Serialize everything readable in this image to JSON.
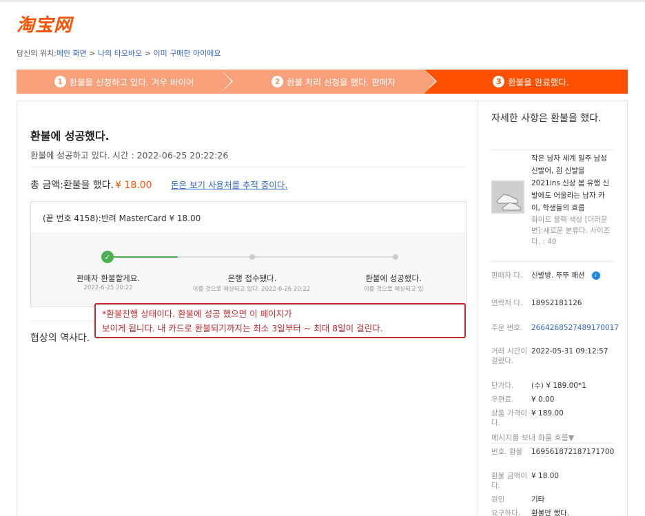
{
  "logo": "淘宝网",
  "breadcrumb": {
    "prefix": "당신의 위치:",
    "items": [
      "메인 화면",
      "나의 타오바오",
      "이미 구매한 아이에요"
    ],
    "separator": " > "
  },
  "steps": [
    {
      "num": "1",
      "label": "환불을 신청하고 있다. 겨우 바이어"
    },
    {
      "num": "2",
      "label": "환불 처리 신청을 했다. 판매자"
    },
    {
      "num": "3",
      "label": "환불을 완료했다."
    }
  ],
  "main": {
    "title": "환불에 성공했다.",
    "time_text": "환불에 성공하고 있다. 시간 : 2022-06-25 20:22:26",
    "total_label": "총 금액:환불을 했다.",
    "total_amount": "¥ 18.00",
    "track_link": "돈은 보기 사용처를 추적 중이다.",
    "card_line": "(끝 번호 4158):반려 MasterCard ¥ 18.00",
    "progress": [
      {
        "label": "판매자 환불할게요.",
        "sub": "2022-6-25 20:22",
        "done": true
      },
      {
        "label": "은행 접수됐다.",
        "sub": "이를 것으로 예상되고 있다. 2022-6-26 20:22",
        "done": false
      },
      {
        "label": "환불에 성공했다.",
        "sub": "이를 것으로 예상되고 있",
        "done": false
      }
    ],
    "history": "협상의 역사다."
  },
  "note": {
    "line1": "*환불진행 상태이다. 환불에 성공 했으면 이 페이지가",
    "line2": "보이게 됩니다. 내 카드로 환불되기까지는 최소 3일부터 ~ 최대 8일이 걸린다."
  },
  "side": {
    "title": "자세한 사항은 환불을 했다.",
    "product_name": "작은 남자 세계 일주 남성 신발어, 흰 신발을 2021ins 신상 봄 유행 신발에도 어울리는 남자 카이, 학생들의 흐름",
    "product_spec": "화이트 블랙 색상 [더러운 변]:새로운 분류다. 사이즈다. : 40",
    "rows1": [
      {
        "k": "판매자 다.",
        "v": "신발방. 뚜뚜 패션"
      },
      {
        "k": "연락처 다.",
        "v": "18952181126"
      },
      {
        "k": "주문 번호.",
        "v": "2664268527489170017",
        "link": true
      },
      {
        "k": "거래 시간이 걸렸다.",
        "v": "2022-05-31 09:12:57"
      },
      {
        "k": "단가다.",
        "v": "(수) ¥ 189.00*1"
      },
      {
        "k": "우편료.",
        "v": "¥ 0.00"
      },
      {
        "k": "상품 가격이다.",
        "v": "¥ 189.00"
      }
    ],
    "msg": "메시지를 보내 화물 흐름▼",
    "rows2": [
      {
        "k": "번호. 환불",
        "v": "169561872187171700"
      },
      {
        "k": "환불 금액이다.",
        "v": "¥ 18.00"
      },
      {
        "k": "원인",
        "v": "기타"
      },
      {
        "k": "요구하다.",
        "v": "환불만 했다."
      }
    ]
  },
  "colors": {
    "brand": "#ff5000",
    "step_light": "#f7a07a",
    "link": "#3366cc",
    "success": "#4caf50",
    "note": "#c0282d"
  }
}
